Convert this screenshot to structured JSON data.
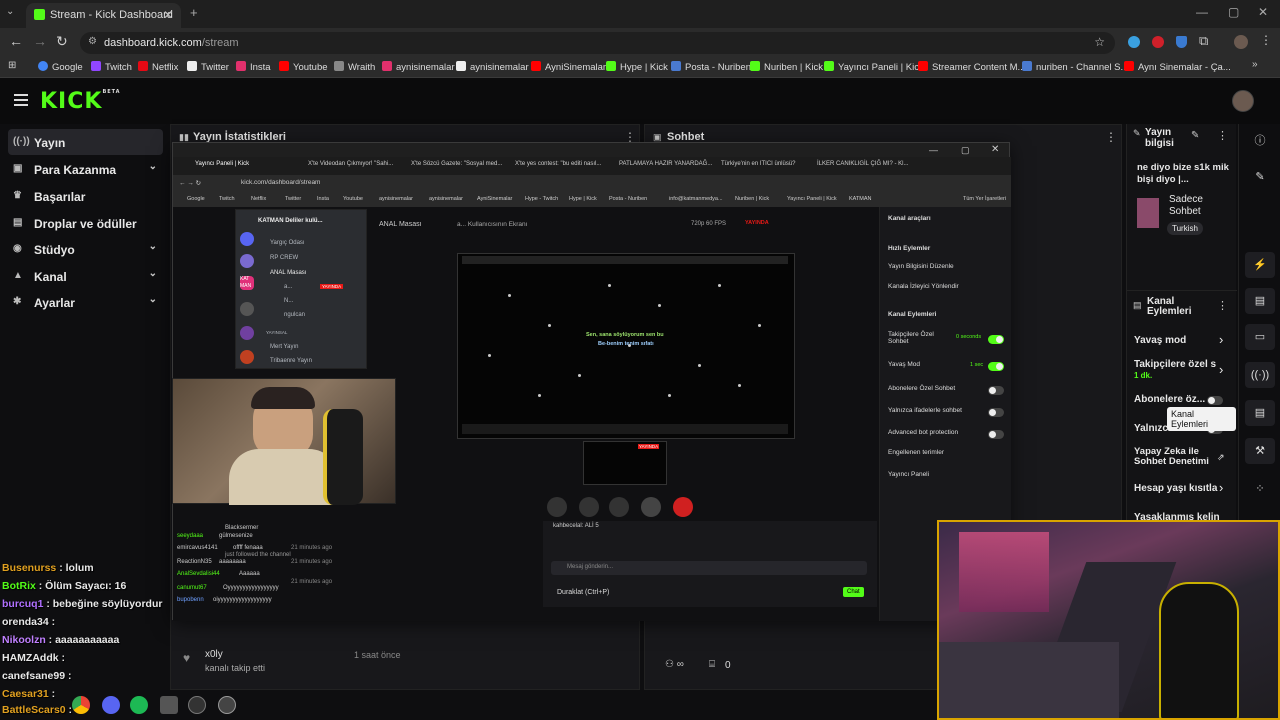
{
  "browser": {
    "tab_title": "Stream - Kick Dashboard",
    "url_domain": "dashboard.kick.com",
    "url_path": "/stream",
    "bookmarks": [
      "Google",
      "Twitch",
      "Netflix",
      "Twitter",
      "Insta",
      "Youtube",
      "Wraith",
      "aynisinemalar",
      "aynisinemalar",
      "AyniSinemalar",
      "Hype | Kick",
      "Posta - Nuriben",
      "Nuriben | Kick",
      "Yayıncı Paneli | Kick",
      "Streamer Content M...",
      "nuriben - Channel S...",
      "Aynı Sinemalar - Ça..."
    ]
  },
  "kick": {
    "logo": "KICK",
    "logo_beta": "BETA"
  },
  "sidebar": {
    "items": [
      {
        "icon": "((·))",
        "label": "Yayın"
      },
      {
        "icon": "▣",
        "label": "Para Kazanma"
      },
      {
        "icon": "♛",
        "label": "Başarılar"
      },
      {
        "icon": "▤",
        "label": "Droplar ve ödüller"
      },
      {
        "icon": "◉",
        "label": "Stüdyo"
      },
      {
        "icon": "▲",
        "label": "Kanal"
      },
      {
        "icon": "✱",
        "label": "Ayarlar"
      }
    ]
  },
  "panels": {
    "stats_title": "Yayın İstatistikleri",
    "chat_title": "Sohbet",
    "info_title": "Yayın bilgisi",
    "info_text": "ne diyo bize s1k mik bişi diyo |...",
    "info_category": "Sadece Sohbet",
    "info_tag": "Turkish",
    "actions_title": "Kanal Eylemleri",
    "actions": [
      {
        "label": "Yavaş mod"
      },
      {
        "label": "Takipçilere özel s",
        "sub": "1 dk."
      },
      {
        "label": "Abonelere öz..."
      },
      {
        "label": "Yalnızca..."
      },
      {
        "label": "Yapay Zeka ile Sohbet Denetimi"
      },
      {
        "label": "Hesap yaşı kısıtla"
      },
      {
        "label": "Yasaklanmış kelin"
      }
    ],
    "tooltip": "Kanal Eylemleri",
    "follow_user": "x0ly",
    "follow_text": "kanalı takip etti",
    "follow_time": "1 saat önce",
    "bottom_count": "0"
  },
  "inner": {
    "tabs": [
      "Yayıncı Paneli | Kick",
      "X'te Videodan Çıkmıyor! \"Sahi...",
      "X'te Sözcü Gazete: \"Sosyal med...",
      "X'te yes contest: \"bu editi nasıl...",
      "PATLAMAYA HAZIR YANARDAĞ...",
      "Türkiye'nin en ITICI ünlüsü?",
      "İLKER CANIKLIGİL ÇIĞ MI? - Kl..."
    ],
    "url": "kick.com/dashboard/stream",
    "bookmarks": [
      "Google",
      "Twitch",
      "Netflix",
      "Twitter",
      "Insta",
      "Youtube",
      "aynisinemalar",
      "aynisinemalar",
      "AyniSinemalar",
      "Hype - Twitch",
      "Hype | Kick",
      "Posta - Nuriben",
      "info@katmanmedya...",
      "Nuriben | Kick",
      "Yayıncı Paneli | Kick",
      "KATMAN",
      "Tüm Yer İşaretleri"
    ],
    "call_title": "ANAL Masası",
    "screen_label": "a... Kullanıcısının Ekranı",
    "video_quality": "720p 60 FPS",
    "live_badge": "YAYINDA",
    "lyrics_1": "Sen, sana söylüyorum sen bu",
    "lyrics_2": "Be-benim tenim sıfatı",
    "discord_server": "KATMAN Deliler kulü...",
    "discord_channels": [
      "Yargıç Odası",
      "RP CREW",
      "ANAL Masası",
      "a...",
      "N...",
      "ngulcan",
      "YAYINSAL",
      "Mert Yayın",
      "Tribaenre Yayın"
    ],
    "discord_live": "YAYINDA",
    "kanal_araclari": "Kanal araçları",
    "hizli_eylemler": "Hızlı Eylemler",
    "hizli_items": [
      "Yayın Bilgisini Düzenle",
      "Kanala İzleyici Yönlendir"
    ],
    "kanal_eylemleri": "Kanal Eylemleri",
    "kanal_items": [
      {
        "label": "Takipçilere Özel Sohbet",
        "value": "0 seconds",
        "on": true
      },
      {
        "label": "Yavaş Mod",
        "value": "1 sec",
        "on": true
      },
      {
        "label": "Abonelere Özel Sohbet",
        "value": "",
        "on": false
      },
      {
        "label": "Yalnızca ifadelerle sohbet",
        "value": "",
        "on": false
      },
      {
        "label": "Advanced bot protection",
        "value": "",
        "on": false
      },
      {
        "label": "Engellenen terimler",
        "value": "",
        "on": false
      },
      {
        "label": "Yayıncı Paneli",
        "value": "",
        "on": false
      }
    ],
    "chat_user": "kahbecelal: ALİ 5",
    "msg_placeholder": "Mesaj gönderin...",
    "pause_btn": "Duraklat (Ctrl+P)",
    "chat_btn": "Chat",
    "activity": [
      {
        "user": "seeydaaa",
        "text": "gülmesenize",
        "time": ""
      },
      {
        "user": "emircavus4141",
        "text": "offff fenaaa",
        "time": "21 minutes ago"
      },
      {
        "user": "ReactionN35",
        "text": "aaaaaaaa",
        "time": "21 minutes ago"
      },
      {
        "user": "AnalSevdalisi44",
        "text": "Aaaaaa",
        "time": ""
      },
      {
        "user": "canumut67",
        "text": "Oyyyyyyyyyyyyyyyyy",
        "time": "21 minutes ago"
      },
      {
        "user": "bupobenn",
        "text": "oiyyyyyyyyyyyyyyyyyy",
        "time": ""
      },
      {
        "user": "kahbecelal",
        "text": "ALİ 5",
        "time": ""
      }
    ],
    "followed": "just followed the channel",
    "blacksermer": "Blacksermer"
  },
  "overlay_chat": [
    {
      "user": "Busenurss",
      "text": ": lolum",
      "color": "#e0a020"
    },
    {
      "user": "BotRix",
      "text": ": Ölüm Sayacı: 16",
      "color": "#53fc18"
    },
    {
      "user": "burcuq1",
      "text": ": bebeğine söylüyordur",
      "color": "#b070ff"
    },
    {
      "user": "orenda34",
      "text": ":",
      "color": "#e8e8e8"
    },
    {
      "user": "Nikoolzn",
      "text": ": aaaaaaaaaaa",
      "color": "#c080ff"
    },
    {
      "user": "HAMZAddk",
      "text": ":",
      "color": "#e8e8e8"
    },
    {
      "user": "canefsane99",
      "text": ":",
      "color": "#e8e8e8"
    },
    {
      "user": "Caesar31",
      "text": ":",
      "color": "#e0a020"
    },
    {
      "user": "BattleScars0",
      "text": ":",
      "color": "#e0a020"
    }
  ],
  "colors": {
    "kick_green": "#53fc18",
    "panel_bg": "#18181b",
    "page_bg": "#0e0e10",
    "live_red": "#e91916",
    "webcam_border": "#d9a400"
  }
}
